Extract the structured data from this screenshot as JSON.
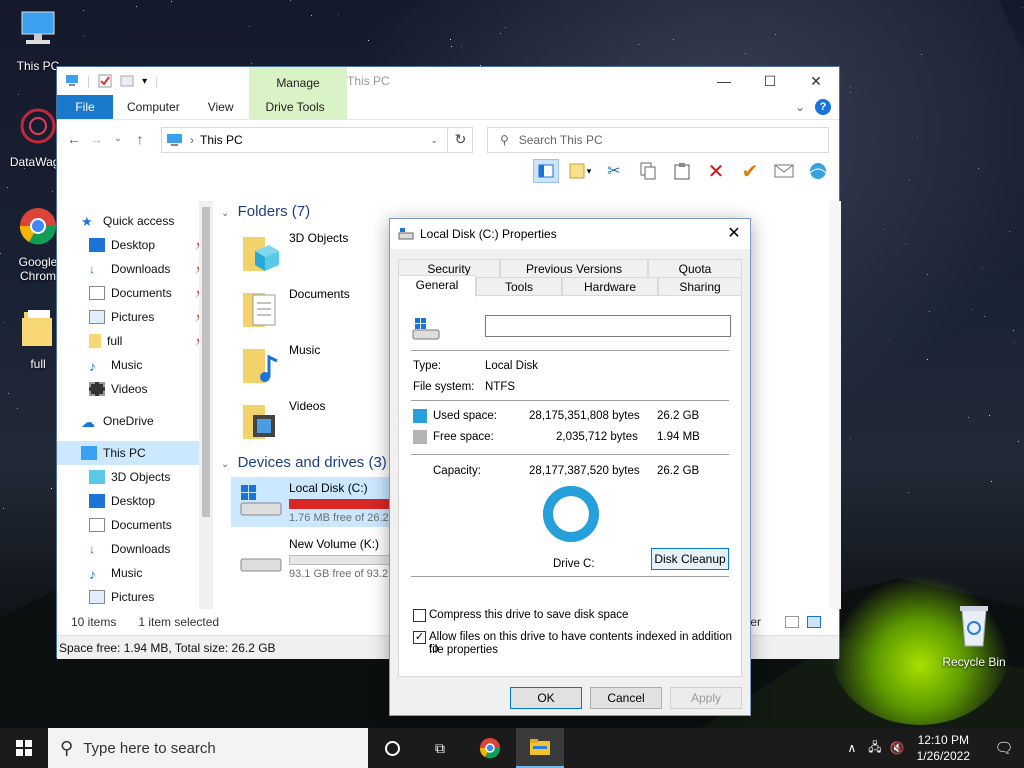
{
  "desktop": {
    "icons": [
      {
        "label": "This PC"
      },
      {
        "label": "DataWago"
      },
      {
        "label": "Google Chrom"
      },
      {
        "label": "full"
      },
      {
        "label": "Recycle Bin"
      }
    ]
  },
  "explorer": {
    "title": "This PC",
    "manage_tab": "Manage",
    "ribbon_tabs": [
      "File",
      "Computer",
      "View",
      "Drive Tools"
    ],
    "address": "This PC",
    "search_placeholder": "Search This PC",
    "nav": {
      "quick_access": "Quick access",
      "quick_items": [
        "Desktop",
        "Downloads",
        "Documents",
        "Pictures",
        "full",
        "Music",
        "Videos"
      ],
      "onedrive": "OneDrive",
      "this_pc": "This PC",
      "pc_items": [
        "3D Objects",
        "Desktop",
        "Documents",
        "Downloads",
        "Music",
        "Pictures"
      ]
    },
    "folders_header": "Folders (7)",
    "folders": [
      "3D Objects",
      "Documents",
      "Music",
      "Videos"
    ],
    "drives_header": "Devices and drives (3)",
    "drives": [
      {
        "name": "Local Disk (C:)",
        "free": "1.76 MB free of 26.2",
        "used_fraction": 0.99
      },
      {
        "name": "New Volume (K:)",
        "free": "93.1 GB free of 93.2",
        "used_fraction": 0.01
      }
    ],
    "status_items": "10 items",
    "status_selected": "1 item selected",
    "status_space": "Space free: 1.94 MB, Total size: 26.2 GB",
    "status_right": "ter"
  },
  "dialog": {
    "title": "Local Disk (C:) Properties",
    "tabs_row1": [
      "Security",
      "Previous Versions",
      "Quota"
    ],
    "tabs_row2": [
      "General",
      "Tools",
      "Hardware",
      "Sharing"
    ],
    "label_value": "",
    "type_label": "Type:",
    "type_value": "Local Disk",
    "fs_label": "File system:",
    "fs_value": "NTFS",
    "used_label": "Used space:",
    "used_bytes": "28,175,351,808 bytes",
    "used_size": "26.2 GB",
    "free_label": "Free space:",
    "free_bytes": "2,035,712 bytes",
    "free_size": "1.94 MB",
    "cap_label": "Capacity:",
    "cap_bytes": "28,177,387,520 bytes",
    "cap_size": "26.2 GB",
    "drive_label": "Drive C:",
    "cleanup": "Disk Cleanup",
    "compress": "Compress this drive to save disk space",
    "index_line1": "Allow files on this drive to have contents indexed in addition to",
    "index_line2": "file properties",
    "ok": "OK",
    "cancel": "Cancel",
    "apply": "Apply",
    "colors": {
      "used": "#26a0da",
      "free": "#b4b4b4"
    }
  },
  "taskbar": {
    "search_placeholder": "Type here to search",
    "time": "12:10 PM",
    "date": "1/26/2022"
  }
}
